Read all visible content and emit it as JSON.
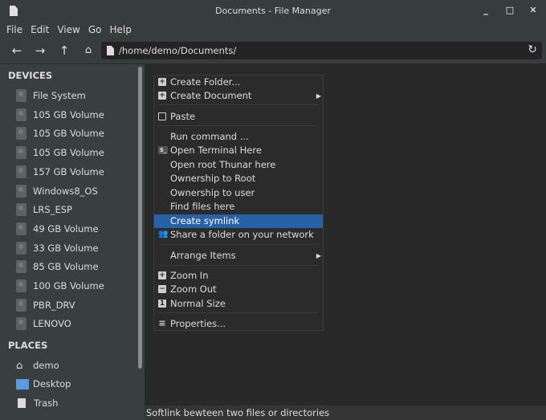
{
  "window": {
    "title": "Documents - File Manager"
  },
  "menubar": [
    "File",
    "Edit",
    "View",
    "Go",
    "Help"
  ],
  "location": {
    "path": "/home/demo/Documents/"
  },
  "sidebar": {
    "devices_label": "DEVICES",
    "devices": [
      "File System",
      "105 GB Volume",
      "105 GB Volume",
      "105 GB Volume",
      "157 GB Volume",
      "Windows8_OS",
      "LRS_ESP",
      "49 GB Volume",
      "33 GB Volume",
      "85 GB Volume",
      "100 GB Volume",
      "PBR_DRV",
      "LENOVO"
    ],
    "places_label": "PLACES",
    "places": [
      "demo",
      "Desktop",
      "Trash"
    ]
  },
  "context_menu": {
    "items": [
      "Create Folder...",
      "Create Document",
      "Paste",
      "Run command ...",
      "Open Terminal Here",
      "Open root Thunar here",
      "Ownership to Root",
      "Ownership to user",
      "Find files here",
      "Create symlink",
      "Share a folder on your network",
      "Arrange Items",
      "Zoom In",
      "Zoom Out",
      "Normal Size",
      "Properties..."
    ]
  },
  "status": "Softlink bewteen two files or directories",
  "colors": {
    "highlight": "#2862a6"
  }
}
